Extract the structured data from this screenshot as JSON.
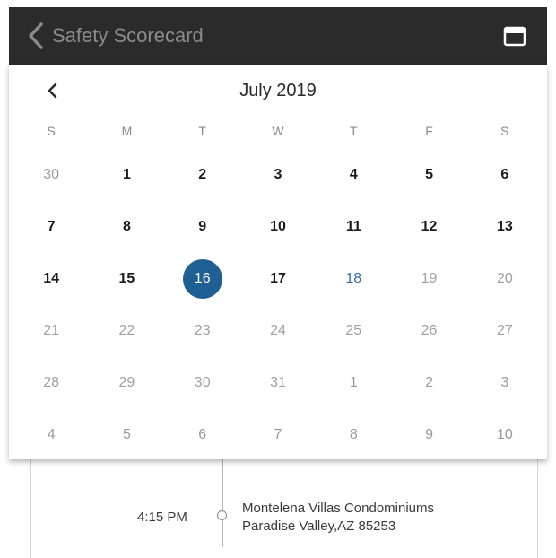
{
  "header": {
    "title": "Safety Scorecard",
    "back_icon": "chevron-left-icon",
    "calendar_icon": "calendar-icon",
    "background": "#2b2b2b"
  },
  "calendar": {
    "month_label": "July 2019",
    "prev_icon": "chevron-left-icon",
    "weekdays": [
      "S",
      "M",
      "T",
      "W",
      "T",
      "F",
      "S"
    ],
    "selected_day": "16",
    "selected_color": "#1e5f94",
    "today_day": "18",
    "today_color": "#2f6ea6",
    "weeks": [
      [
        {
          "d": "30",
          "s": "out"
        },
        {
          "d": "1",
          "s": "in"
        },
        {
          "d": "2",
          "s": "in"
        },
        {
          "d": "3",
          "s": "in"
        },
        {
          "d": "4",
          "s": "in"
        },
        {
          "d": "5",
          "s": "in"
        },
        {
          "d": "6",
          "s": "in"
        }
      ],
      [
        {
          "d": "7",
          "s": "in"
        },
        {
          "d": "8",
          "s": "in"
        },
        {
          "d": "9",
          "s": "in"
        },
        {
          "d": "10",
          "s": "in"
        },
        {
          "d": "11",
          "s": "in"
        },
        {
          "d": "12",
          "s": "in"
        },
        {
          "d": "13",
          "s": "in"
        }
      ],
      [
        {
          "d": "14",
          "s": "in"
        },
        {
          "d": "15",
          "s": "in"
        },
        {
          "d": "16",
          "s": "selected"
        },
        {
          "d": "17",
          "s": "in"
        },
        {
          "d": "18",
          "s": "today"
        },
        {
          "d": "19",
          "s": "future"
        },
        {
          "d": "20",
          "s": "future"
        }
      ],
      [
        {
          "d": "21",
          "s": "future"
        },
        {
          "d": "22",
          "s": "future"
        },
        {
          "d": "23",
          "s": "future"
        },
        {
          "d": "24",
          "s": "future"
        },
        {
          "d": "25",
          "s": "future"
        },
        {
          "d": "26",
          "s": "future"
        },
        {
          "d": "27",
          "s": "future"
        }
      ],
      [
        {
          "d": "28",
          "s": "future"
        },
        {
          "d": "29",
          "s": "future"
        },
        {
          "d": "30",
          "s": "future"
        },
        {
          "d": "31",
          "s": "future"
        },
        {
          "d": "1",
          "s": "out"
        },
        {
          "d": "2",
          "s": "out"
        },
        {
          "d": "3",
          "s": "out"
        }
      ],
      [
        {
          "d": "4",
          "s": "out"
        },
        {
          "d": "5",
          "s": "out"
        },
        {
          "d": "6",
          "s": "out"
        },
        {
          "d": "7",
          "s": "out"
        },
        {
          "d": "8",
          "s": "out"
        },
        {
          "d": "9",
          "s": "out"
        },
        {
          "d": "10",
          "s": "out"
        }
      ]
    ]
  },
  "trips": [
    {
      "time": "4:15 PM",
      "location_name": "Montelena Villas Condominiums",
      "location_address": "Paradise Valley,AZ 85253",
      "timeline_icon": "timeline-dot-icon"
    }
  ]
}
